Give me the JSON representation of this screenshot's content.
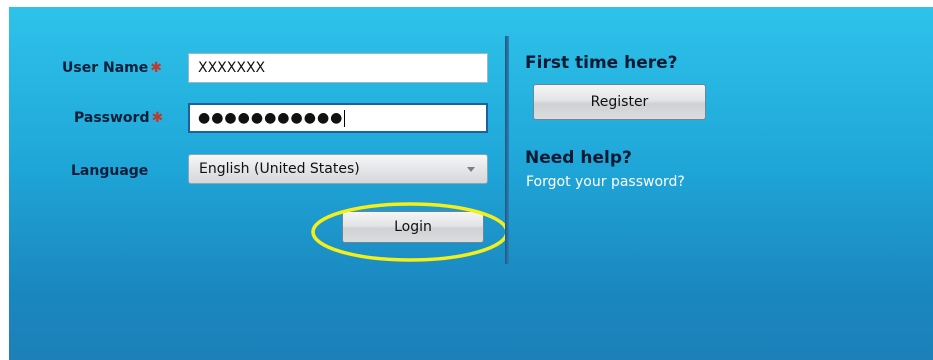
{
  "form": {
    "username_label": "User Name",
    "password_label": "Password",
    "language_label": "Language",
    "required_marker": "✱",
    "username_value": "XXXXXXX",
    "password_value": "●●●●●●●●●●●",
    "language_value": "English (United States)",
    "login_label": "Login"
  },
  "side": {
    "first_time_heading": "First time here?",
    "register_label": "Register",
    "help_heading": "Need help?",
    "forgot_link": "Forgot your password?"
  },
  "colors": {
    "panel_top": "#2ec3ea",
    "panel_bottom": "#1d80b8",
    "highlight_ring": "#f2ef1a",
    "required": "#c0392b"
  }
}
